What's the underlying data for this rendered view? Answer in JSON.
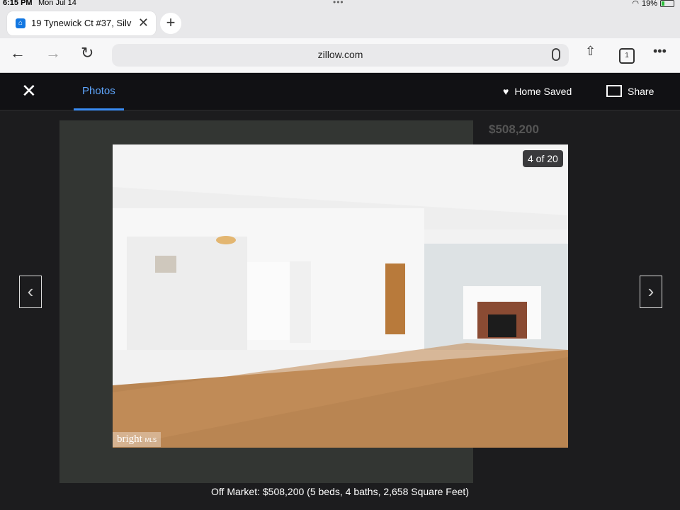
{
  "status": {
    "time": "6:15 PM",
    "date": "Mon Jul 14",
    "battery": "19%"
  },
  "tab": {
    "title": "19 Tynewick Ct #37, Silv",
    "icon": "zillow-icon"
  },
  "address_bar": {
    "url": "zillow.com",
    "tab_count": "1"
  },
  "viewer": {
    "tab_label": "Photos",
    "saved_label": "Home Saved",
    "share_label": "Share",
    "counter": "4 of 20",
    "caption": "Off Market: $508,200 (5 beds, 4 baths, 2,658 Square Feet)",
    "watermark": "bright",
    "watermark_small": "MLS"
  },
  "background": {
    "price": "$508,200"
  },
  "colors": {
    "accent": "#3a8cf3",
    "tab_text": "#5fa7ff"
  }
}
